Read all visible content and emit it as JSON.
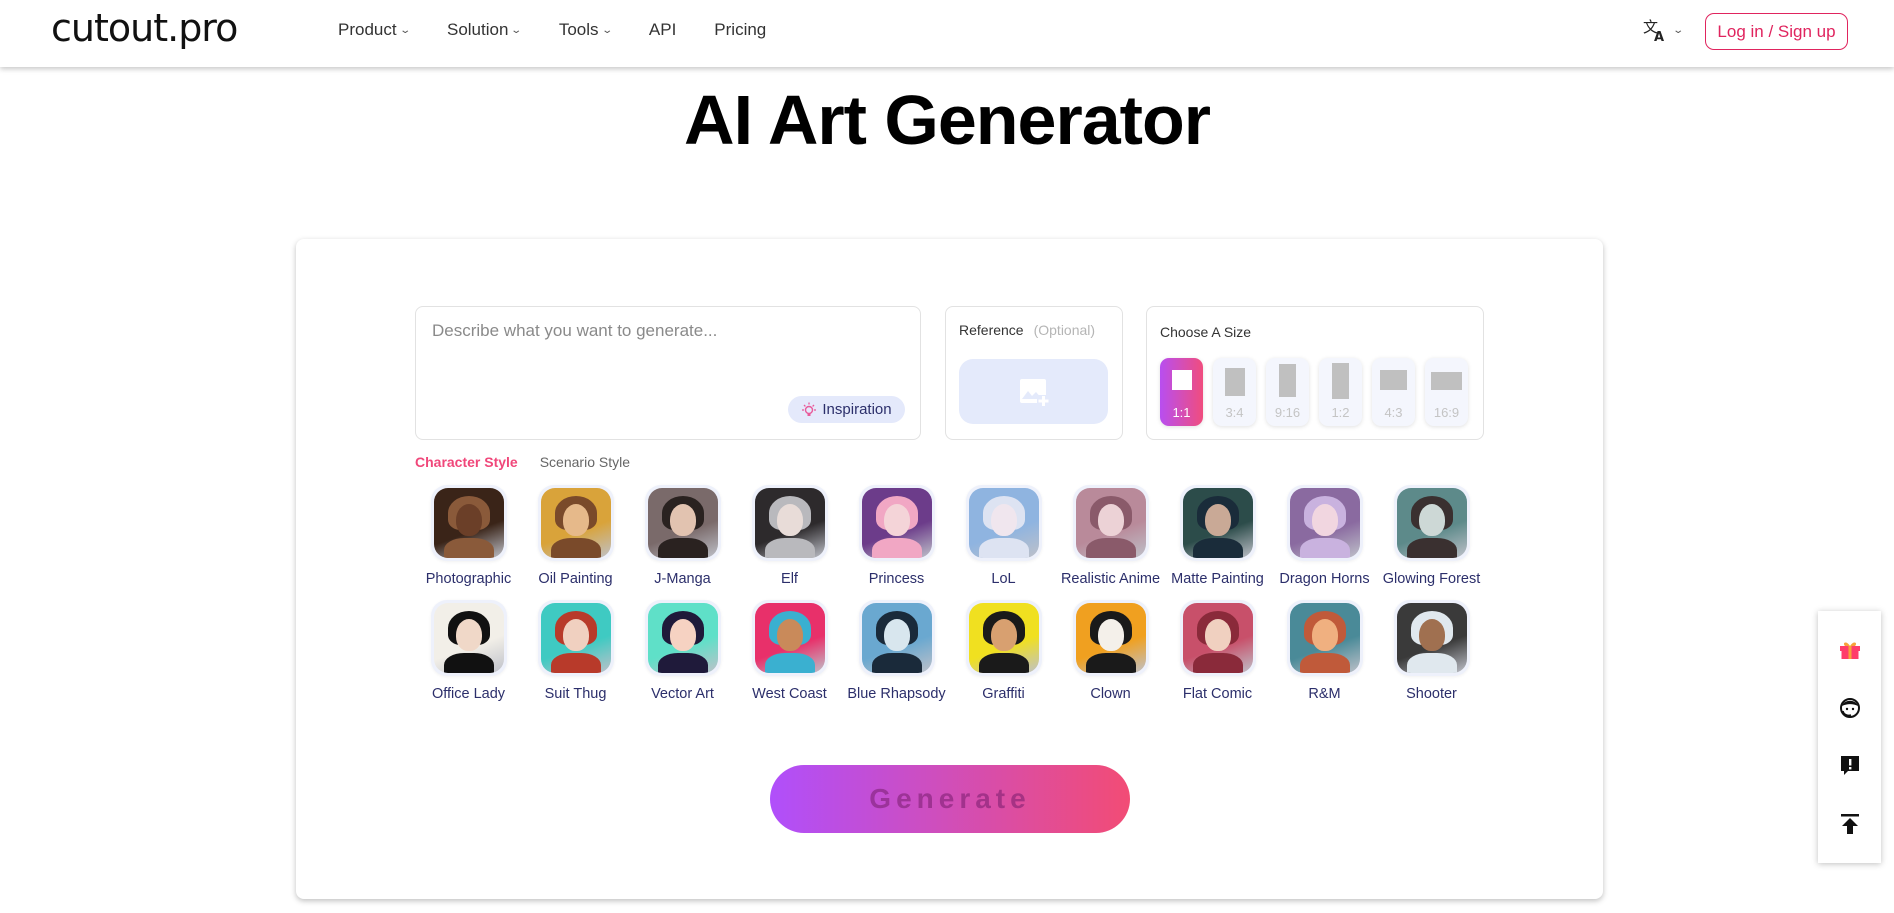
{
  "header": {
    "logo": "cutout.pro",
    "nav": [
      {
        "label": "Product",
        "has_dropdown": true
      },
      {
        "label": "Solution",
        "has_dropdown": true
      },
      {
        "label": "Tools",
        "has_dropdown": true
      },
      {
        "label": "API",
        "has_dropdown": false
      },
      {
        "label": "Pricing",
        "has_dropdown": false
      }
    ],
    "language_icon": "translate-icon",
    "login_label": "Log in / Sign up"
  },
  "page": {
    "title": "AI Art Generator"
  },
  "prompt": {
    "placeholder": "Describe what you want to generate...",
    "value": "",
    "inspiration_label": "Inspiration",
    "inspiration_icon": "lightbulb-icon"
  },
  "reference": {
    "title": "Reference",
    "optional_label": "(Optional)",
    "upload_icon": "add-image-icon"
  },
  "size": {
    "title": "Choose A Size",
    "selected": "1:1",
    "options": [
      {
        "ratio": "1:1",
        "active": true
      },
      {
        "ratio": "3:4",
        "active": false
      },
      {
        "ratio": "9:16",
        "active": false
      },
      {
        "ratio": "1:2",
        "active": false
      },
      {
        "ratio": "4:3",
        "active": false
      },
      {
        "ratio": "16:9",
        "active": false
      }
    ]
  },
  "tabs": [
    {
      "label": "Character Style",
      "active": true
    },
    {
      "label": "Scenario Style",
      "active": false
    }
  ],
  "styles": [
    {
      "label": "Photographic",
      "colors": [
        "#3a2418",
        "#6b3f28",
        "#8a5a3a"
      ]
    },
    {
      "label": "Oil Painting",
      "colors": [
        "#d9a33a",
        "#e6b98a",
        "#7a4a2a"
      ]
    },
    {
      "label": "J-Manga",
      "colors": [
        "#7a6a6a",
        "#e2c3b0",
        "#2a2220"
      ]
    },
    {
      "label": "Elf",
      "colors": [
        "#2d2a2c",
        "#e8dcd8",
        "#b9b9bd"
      ]
    },
    {
      "label": "Princess",
      "colors": [
        "#6c3c8a",
        "#f4d4d8",
        "#f1a7c4"
      ]
    },
    {
      "label": "LoL",
      "colors": [
        "#8fb4e0",
        "#f0e6ee",
        "#dde3f2"
      ]
    },
    {
      "label": "Realistic Anime",
      "colors": [
        "#b98a9a",
        "#ecd2d6",
        "#8a5a6a"
      ]
    },
    {
      "label": "Matte Painting",
      "colors": [
        "#2c4c4a",
        "#c9a996",
        "#1a2c3a"
      ]
    },
    {
      "label": "Dragon Horns",
      "colors": [
        "#8a6aa0",
        "#f1d6e0",
        "#c9b2df"
      ]
    },
    {
      "label": "Glowing Forest",
      "colors": [
        "#5d8a8a",
        "#cdd8d6",
        "#3a3030"
      ]
    },
    {
      "label": "Office Lady",
      "colors": [
        "#f2efe8",
        "#f0d8c8",
        "#111111"
      ]
    },
    {
      "label": "Suit Thug",
      "colors": [
        "#3fcac2",
        "#f0d0c0",
        "#b83a2a"
      ]
    },
    {
      "label": "Vector Art",
      "colors": [
        "#5fe0c8",
        "#f6d2c2",
        "#1f1a3a"
      ]
    },
    {
      "label": "West Coast",
      "colors": [
        "#e8306a",
        "#c98a5a",
        "#3ab0d0"
      ]
    },
    {
      "label": "Blue Rhapsody",
      "colors": [
        "#6aa8d0",
        "#d8e6ee",
        "#1a2a3a"
      ]
    },
    {
      "label": "Graffiti",
      "colors": [
        "#f0e020",
        "#d8a070",
        "#1a1a1a"
      ]
    },
    {
      "label": "Clown",
      "colors": [
        "#f0a020",
        "#f4f0ea",
        "#1a1a1a"
      ]
    },
    {
      "label": "Flat Comic",
      "colors": [
        "#c8506a",
        "#f0d0c0",
        "#8a2a3a"
      ]
    },
    {
      "label": "R&M",
      "colors": [
        "#4a8a98",
        "#f0b080",
        "#c05a3a"
      ]
    },
    {
      "label": "Shooter",
      "colors": [
        "#3a3a3a",
        "#a07050",
        "#e0e8ee"
      ]
    }
  ],
  "generate_label": "Generate",
  "side_toolbar": [
    {
      "icon": "gift-icon"
    },
    {
      "icon": "customer-service-icon"
    },
    {
      "icon": "feedback-icon"
    },
    {
      "icon": "back-to-top-icon"
    }
  ],
  "colors": {
    "accent": "#f0477a",
    "brand_gradient_start": "#b04ffb",
    "brand_gradient_end": "#f24c75",
    "login_border": "#e0245e",
    "label_text": "#2c2f6b"
  }
}
